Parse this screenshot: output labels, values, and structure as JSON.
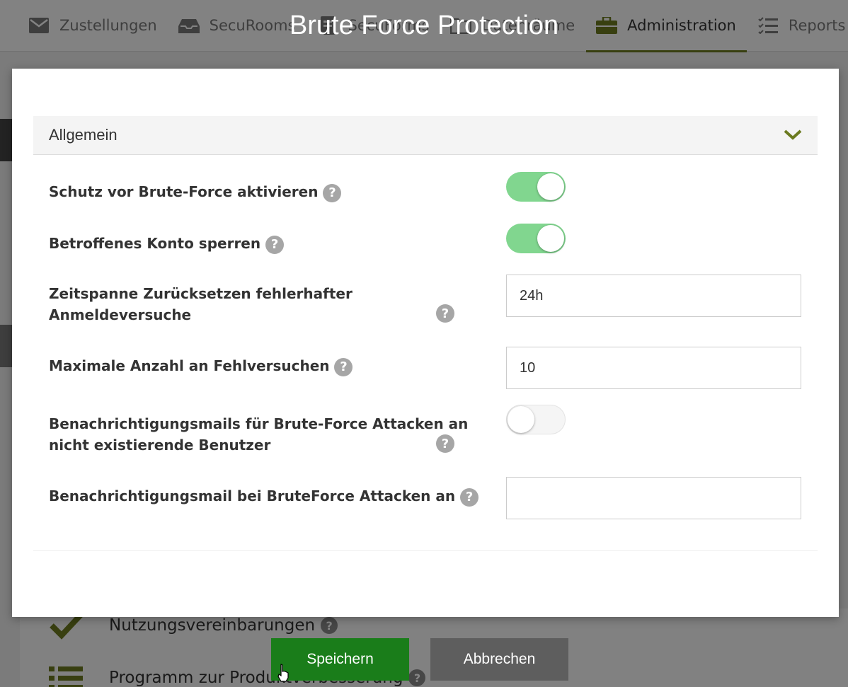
{
  "nav": {
    "items": [
      {
        "label": "Zustellungen",
        "icon": "envelope-icon"
      },
      {
        "label": "SecuRooms",
        "icon": "inbox-icon"
      },
      {
        "label": "SecuForms",
        "icon": "form-icon"
      },
      {
        "label": "Datenräume",
        "icon": "folder-icon"
      },
      {
        "label": "Administration",
        "icon": "briefcase-icon",
        "active": true
      },
      {
        "label": "Reports",
        "icon": "tasks-icon"
      }
    ]
  },
  "background": {
    "rows": [
      {
        "label": "Nutzungsvereinbarungen"
      },
      {
        "label": "Programm zur Produktverbesserung"
      }
    ]
  },
  "modal": {
    "title": "Brute Force Protection",
    "section_title": "Allgemein",
    "settings": [
      {
        "label": "Schutz vor Brute-Force aktivieren",
        "type": "toggle",
        "value": true
      },
      {
        "label": "Betroffenes Konto sperren",
        "type": "toggle",
        "value": true
      },
      {
        "label_line1": "Zeitspanne Zurücksetzen fehlerhafter",
        "label_line2": "Anmeldeversuche",
        "type": "text",
        "value": "24h"
      },
      {
        "label": "Maximale Anzahl an Fehlversuchen",
        "type": "text",
        "value": "10"
      },
      {
        "label_line1": "Benachrichtigungsmails für Brute-Force Attacken an",
        "label_line2": "nicht existierende Benutzer",
        "type": "toggle",
        "value": false
      },
      {
        "label": "Benachrichtigungsmail bei BruteForce Attacken an",
        "type": "text",
        "value": ""
      }
    ],
    "help_glyph": "?",
    "buttons": {
      "save": "Speichern",
      "cancel": "Abbrechen"
    }
  },
  "colors": {
    "accent": "#6b7a1f",
    "toggle_on": "#81d68f",
    "save": "#1a7d1a",
    "cancel": "#5e5e5e"
  }
}
